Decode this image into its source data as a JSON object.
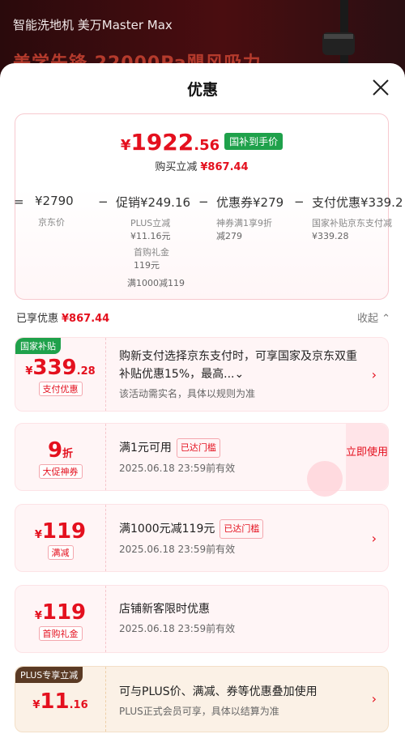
{
  "banner": {
    "line1": "智能洗地机 美万Master Max",
    "line2": "美学先锋 22000Pa飓风吸力"
  },
  "sheet": {
    "title": "优惠",
    "close_icon": "close-icon"
  },
  "summary": {
    "final_price_yen": "¥",
    "final_price_int": "1922",
    "final_price_dec": ".56",
    "final_badge": "国补到手价",
    "saved_label": "购买立减",
    "saved_amount": "¥867.44",
    "formula": [
      {
        "op": "=",
        "value": "¥2790",
        "sub": [
          "京东价"
        ]
      },
      {
        "op": "−",
        "value": "促销¥249.16",
        "sub": [
          "PLUS立减",
          "¥11.16元",
          "首购礼金",
          "119元",
          "满1000减119"
        ]
      },
      {
        "op": "−",
        "value": "优惠券¥279",
        "sub": [
          "神券满1享9折",
          "减279"
        ]
      },
      {
        "op": "−",
        "value": "支付优惠¥339.2",
        "sub": [
          "国家补贴京东支付减",
          "¥339.28"
        ]
      }
    ]
  },
  "enjoyed": {
    "label": "已享优惠",
    "amount": "¥867.44",
    "collapse_label": "收起 ⌃"
  },
  "cards": [
    {
      "corner_tag": "国家补贴",
      "yen": "¥",
      "big": "339",
      "small": ".28",
      "tag": "支付优惠",
      "desc": "购新支付选择京东支付时，可享国家及京东双重补贴优惠15%，最高...⌄",
      "meta": "该活动需实名，具体以规则为准"
    },
    {
      "big": "9",
      "small": "折",
      "tag": "大促神券",
      "desc": "满1元可用",
      "mini_tag": "已达门槛",
      "meta": "2025.06.18 23:59前有效",
      "use_now": "立即使用"
    },
    {
      "yen": "¥",
      "big": "119",
      "tag": "满减",
      "desc": "满1000元减119元",
      "mini_tag": "已达门槛",
      "meta": "2025.06.18 23:59前有效"
    },
    {
      "yen": "¥",
      "big": "119",
      "tag": "首购礼金",
      "desc": "店铺新客限时优惠",
      "meta": "2025.06.18 23:59前有效"
    },
    {
      "corner_tag": "PLUS专享立减",
      "yen": "¥",
      "big": "11",
      "small": ".16",
      "desc": "可与PLUS价、满减、券等优惠叠加使用",
      "meta": "PLUS正式会员可享，具体以结算为准"
    }
  ],
  "colors": {
    "accent": "#e4101e",
    "gov_green": "#1fa14b",
    "plus_brown": "#5a3a24"
  }
}
